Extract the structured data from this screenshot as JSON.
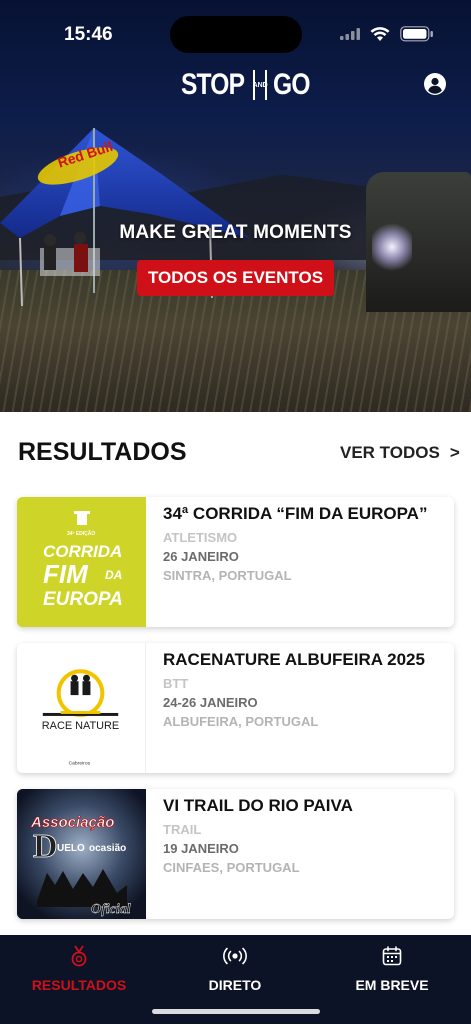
{
  "status_bar": {
    "time": "15:46"
  },
  "brand": {
    "left": "STOP",
    "middle": [
      "AND"
    ],
    "right": "GO"
  },
  "hero": {
    "tent_brand": "Red Bull",
    "tagline": "MAKE GREAT MOMENTS",
    "cta_label": "TODOS OS EVENTOS"
  },
  "results": {
    "title": "RESULTADOS",
    "see_all_label": "VER TODOS",
    "see_all_chevron": ">",
    "events": [
      {
        "name": "34ª CORRIDA “FIM DA EUROPA”",
        "category": "ATLETISMO",
        "date": "26 JANEIRO",
        "location": "SINTRA, PORTUGAL",
        "logo": {
          "edition": "34ª EDIÇÃO",
          "line1": "CORRIDA",
          "line2": "FIM",
          "side": "DA",
          "line3": "EUROPA"
        }
      },
      {
        "name": "RACENATURE ALBUFEIRA 2025",
        "category": "BTT",
        "date": "24-26 JANEIRO",
        "location": "ALBUFEIRA, PORTUGAL",
        "logo": {
          "text": "RACE NATURE",
          "sponsor": "Cabreiros"
        }
      },
      {
        "name": "VI TRAIL DO RIO PAIVA",
        "category": "TRAIL",
        "date": "19 JANEIRO",
        "location": "CINFAES, PORTUGAL",
        "logo": {
          "line1": "Associação",
          "line2a": "UELO",
          "line2b": "ocasião",
          "line3": "Oficial"
        }
      }
    ]
  },
  "tabbar": {
    "tabs": [
      {
        "label": "RESULTADOS",
        "icon": "medal-icon",
        "active": true
      },
      {
        "label": "DIRETO",
        "icon": "broadcast-icon",
        "active": false
      },
      {
        "label": "EM BREVE",
        "icon": "calendar-icon",
        "active": false
      }
    ]
  },
  "colors": {
    "accent_red": "#d01018",
    "tabbar_bg": "#0d1326",
    "thumb_yellow": "#cfd428",
    "text_dark": "#111111"
  }
}
